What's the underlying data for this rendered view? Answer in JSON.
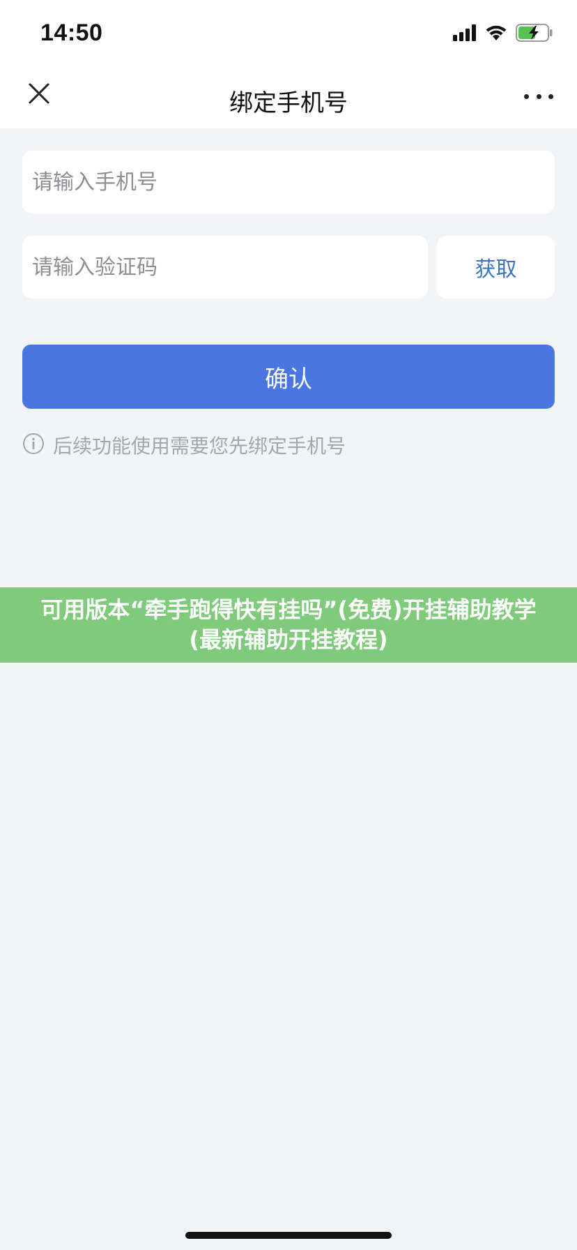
{
  "status_bar": {
    "time": "14:50",
    "icons": [
      "signal-icon",
      "wifi-icon",
      "battery-charging-icon"
    ]
  },
  "nav": {
    "title": "绑定手机号",
    "close_icon": "close-icon",
    "more_icon": "more-icon"
  },
  "form": {
    "phone_placeholder": "请输入手机号",
    "phone_value": "",
    "code_placeholder": "请输入验证码",
    "code_value": "",
    "get_code_label": "获取",
    "confirm_label": "确认"
  },
  "hint": {
    "icon": "info-icon",
    "text": "后续功能使用需要您先绑定手机号"
  },
  "banner": {
    "text": "可用版本“牵手跑得快有挂吗”(免费)开挂辅助教学(最新辅助开挂教程)"
  },
  "colors": {
    "accent": "#4a76e2",
    "link": "#3d73c4",
    "banner": "#7fcb7b",
    "background": "#f2f4f7",
    "hint_text": "#a3a7ad"
  }
}
